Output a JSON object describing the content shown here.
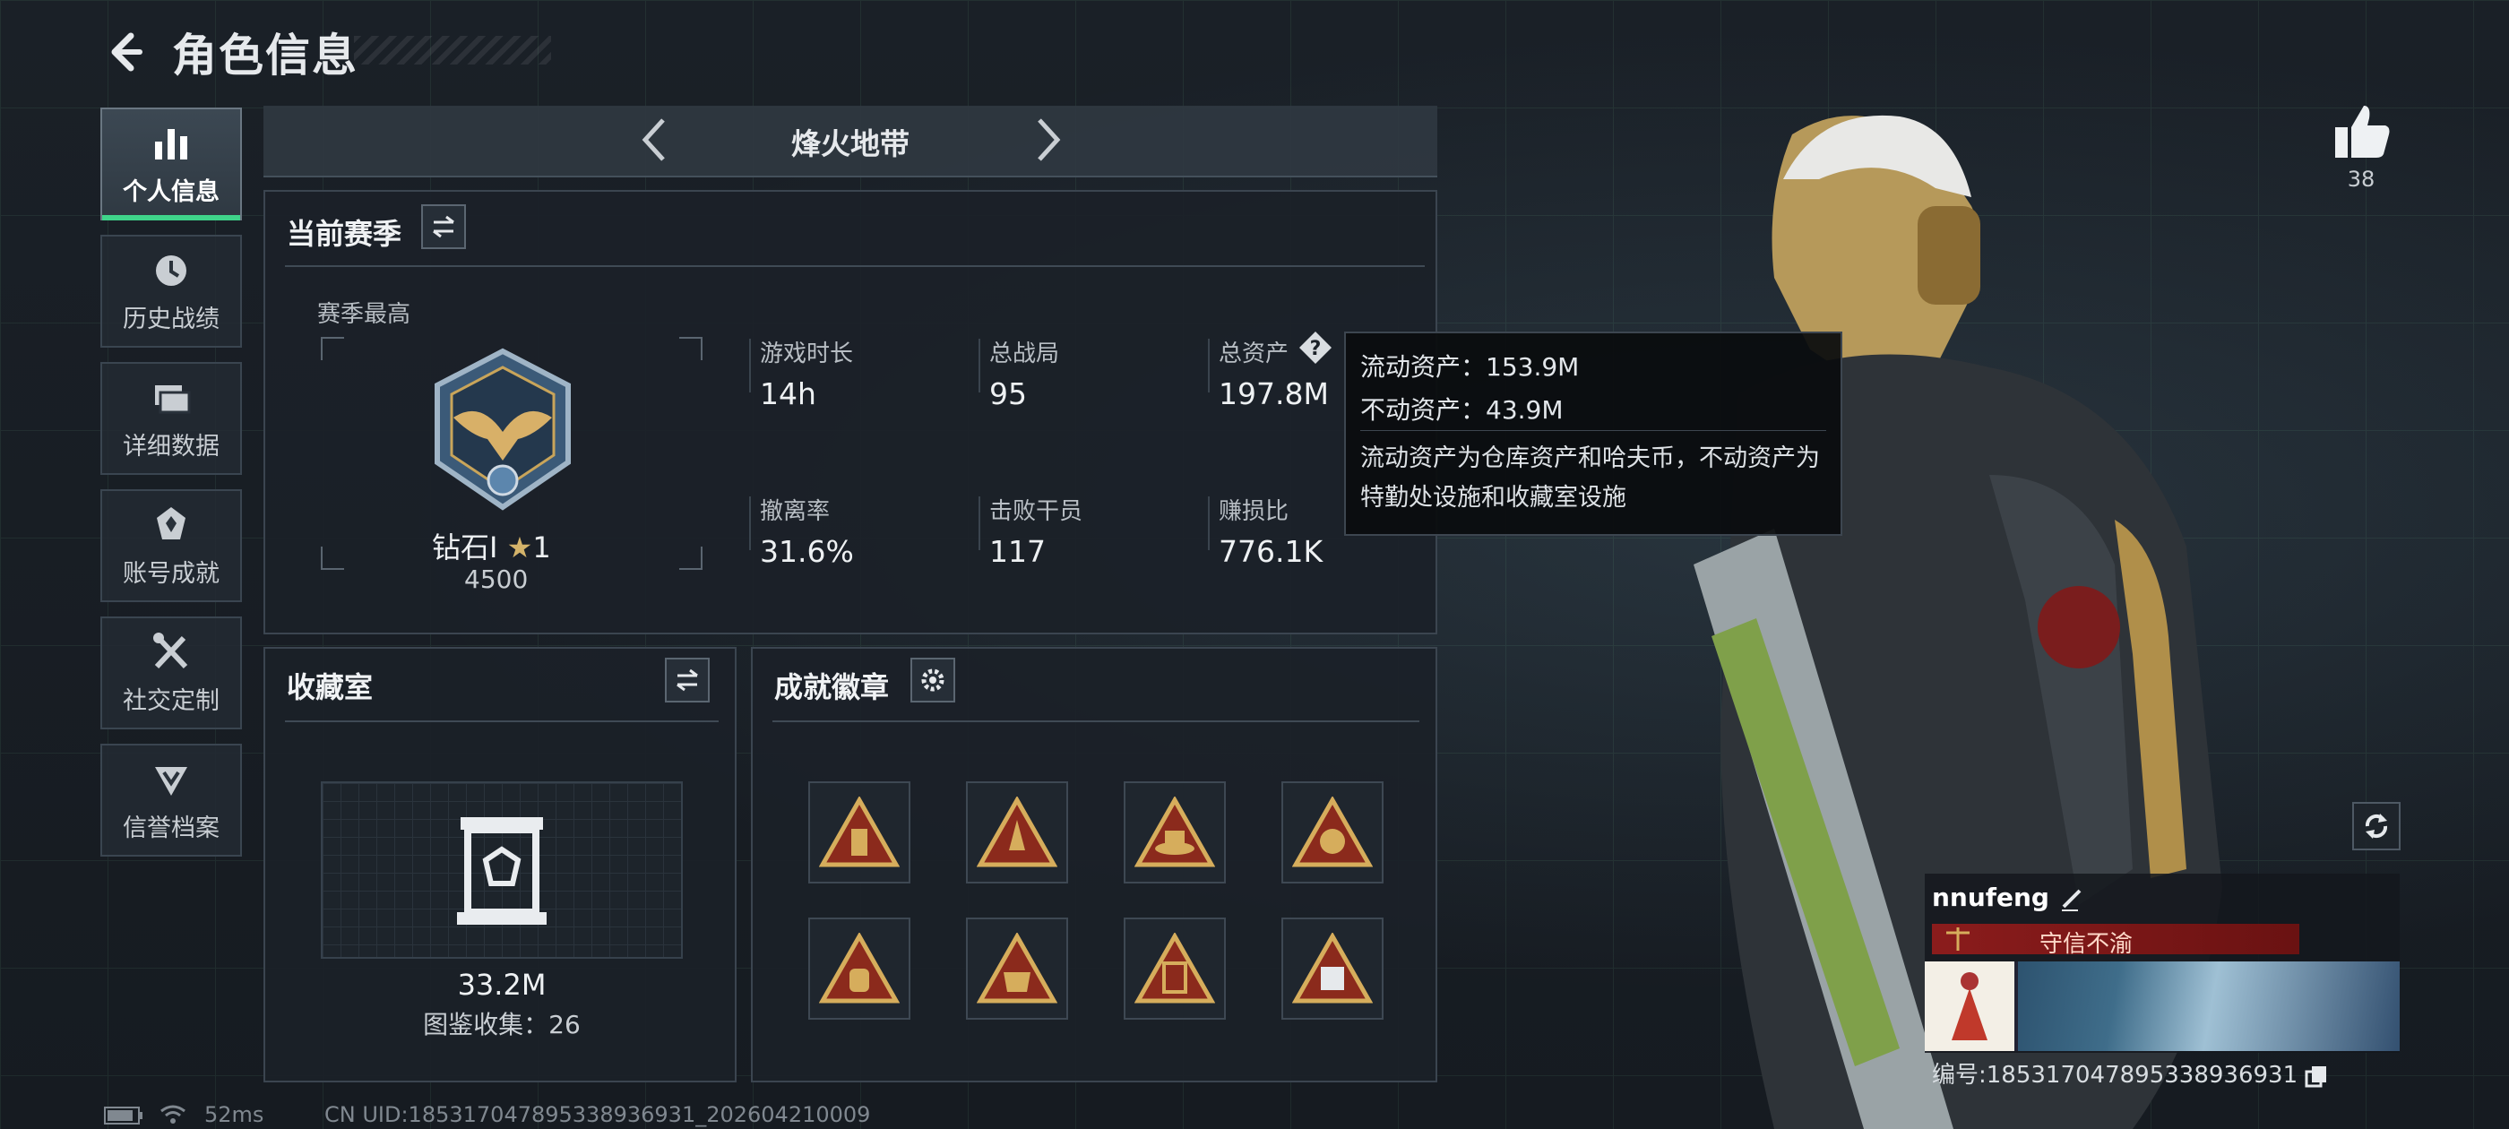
{
  "header": {
    "title": "角色信息"
  },
  "sidebar": {
    "items": [
      {
        "label": "个人信息",
        "icon": "bar-chart-icon",
        "active": true
      },
      {
        "label": "历史战绩",
        "icon": "clock-icon",
        "active": false
      },
      {
        "label": "详细数据",
        "icon": "folder-icon",
        "active": false
      },
      {
        "label": "账号成就",
        "icon": "achievement-icon",
        "active": false
      },
      {
        "label": "社交定制",
        "icon": "tools-icon",
        "active": false
      },
      {
        "label": "信誉档案",
        "icon": "reputation-icon",
        "active": false
      }
    ]
  },
  "mode": {
    "title": "烽火地带"
  },
  "season": {
    "title": "当前赛季",
    "best_label": "赛季最高",
    "rank_name": "钻石I",
    "rank_stars": "1",
    "rank_points": "4500",
    "stats": [
      {
        "label": "游戏时长",
        "value": "14h"
      },
      {
        "label": "总战局",
        "value": "95"
      },
      {
        "label": "总资产",
        "value": "197.8M"
      },
      {
        "label": "撤离率",
        "value": "31.6%"
      },
      {
        "label": "击败干员",
        "value": "117"
      },
      {
        "label": "赚损比",
        "value": "776.1K"
      }
    ]
  },
  "tooltip": {
    "liquid": "流动资产：153.9M",
    "fixed": "不动资产：43.9M",
    "description": "流动资产为仓库资产和哈夫币，不动资产为特勤处设施和收藏室设施"
  },
  "collection": {
    "title": "收藏室",
    "value": "33.2M",
    "count_text": "图鉴收集：26"
  },
  "achievements": {
    "title": "成就徽章",
    "badges": [
      "badge-bottle",
      "badge-rocket",
      "badge-hat",
      "badge-54",
      "badge-55",
      "badge-56",
      "badge-57",
      "badge-58"
    ]
  },
  "profile": {
    "name": "nnufeng",
    "motto": "守信不渝",
    "id_text": "编号:185317047895338936931",
    "likes": "38"
  },
  "footer": {
    "ping": "52ms",
    "uid": "CN UID:185317047895338936931_202604210009"
  },
  "colors": {
    "accent": "#3fd48a",
    "motto": "#8b1c1c"
  }
}
